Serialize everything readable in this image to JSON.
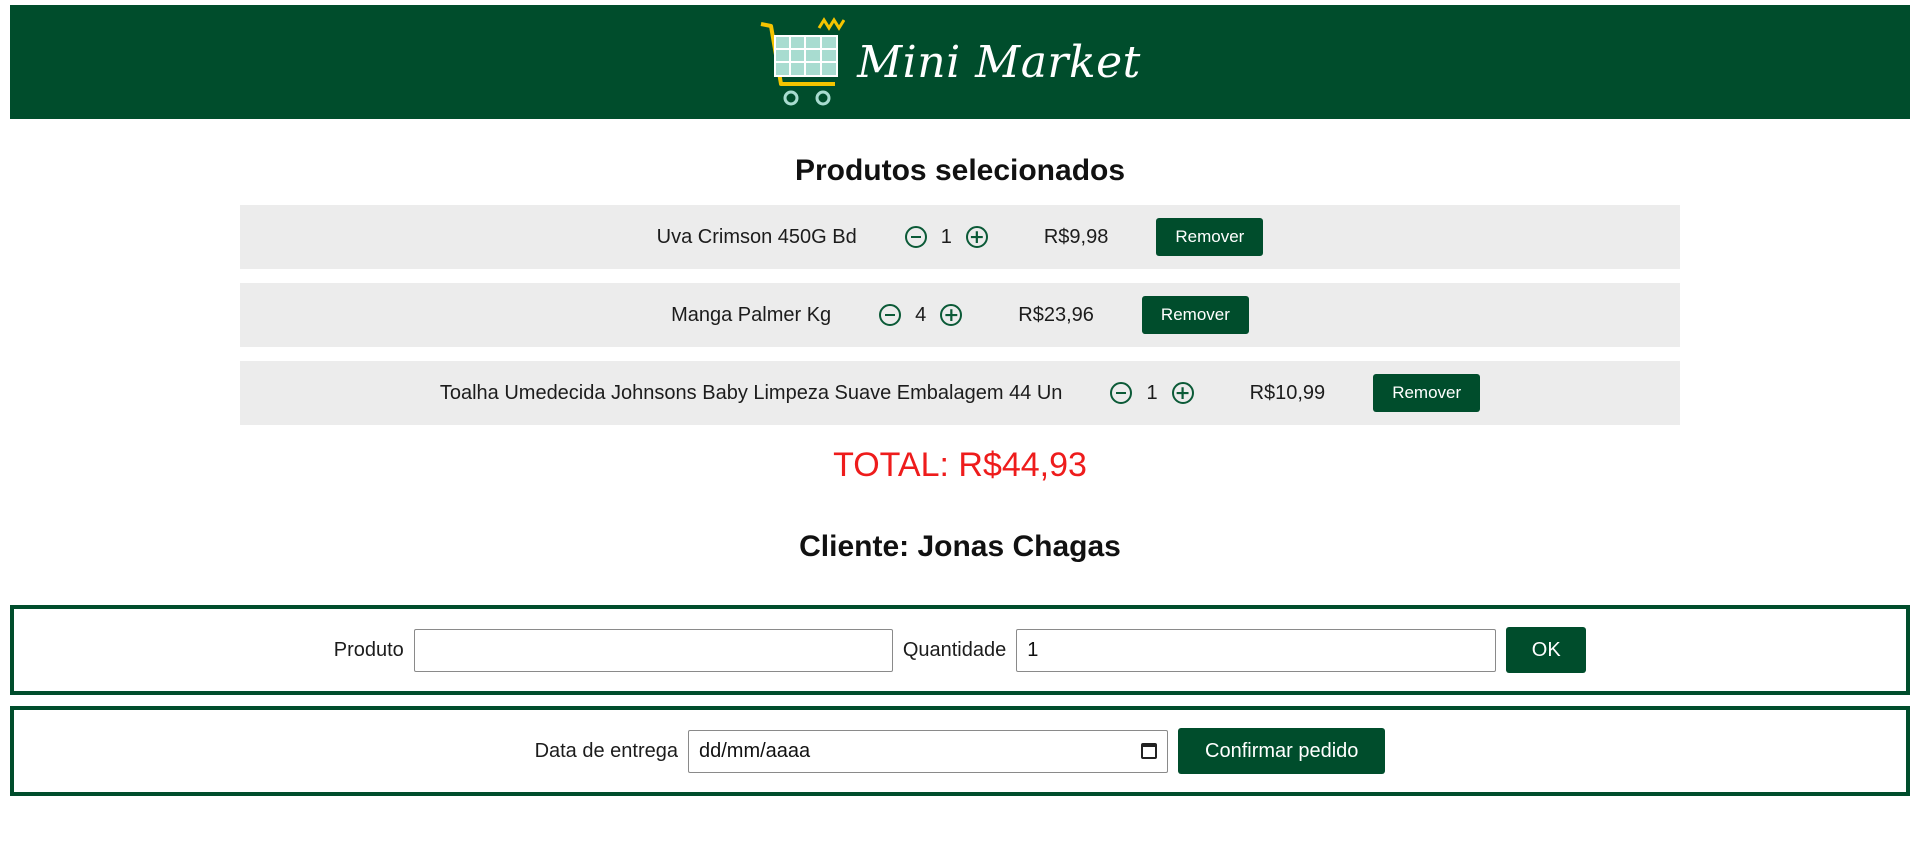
{
  "header": {
    "logo_text": "Mini Market",
    "background": "#004d2c"
  },
  "cart": {
    "title": "Produtos selecionados",
    "items": [
      {
        "name": "Uva Crimson 450G Bd",
        "quantity": "1",
        "price": "R$9,98",
        "remove_label": "Remover"
      },
      {
        "name": "Manga Palmer Kg",
        "quantity": "4",
        "price": "R$23,96",
        "remove_label": "Remover"
      },
      {
        "name": "Toalha Umedecida Johnsons Baby Limpeza Suave Embalagem 44 Un",
        "quantity": "1",
        "price": "R$10,99",
        "remove_label": "Remover"
      }
    ],
    "total": "TOTAL: R$44,93"
  },
  "client": {
    "title": "Cliente: Jonas Chagas"
  },
  "add_form": {
    "product_label": "Produto",
    "product_value": "",
    "quantity_label": "Quantidade",
    "quantity_value": "1",
    "ok_label": "OK"
  },
  "delivery_form": {
    "date_label": "Data de entrega",
    "date_placeholder": "dd/mm/aaaa",
    "confirm_label": "Confirmar pedido"
  },
  "colors": {
    "brand_green": "#004d2c",
    "total_red": "#ee1c1c",
    "row_gray": "#ececec"
  }
}
